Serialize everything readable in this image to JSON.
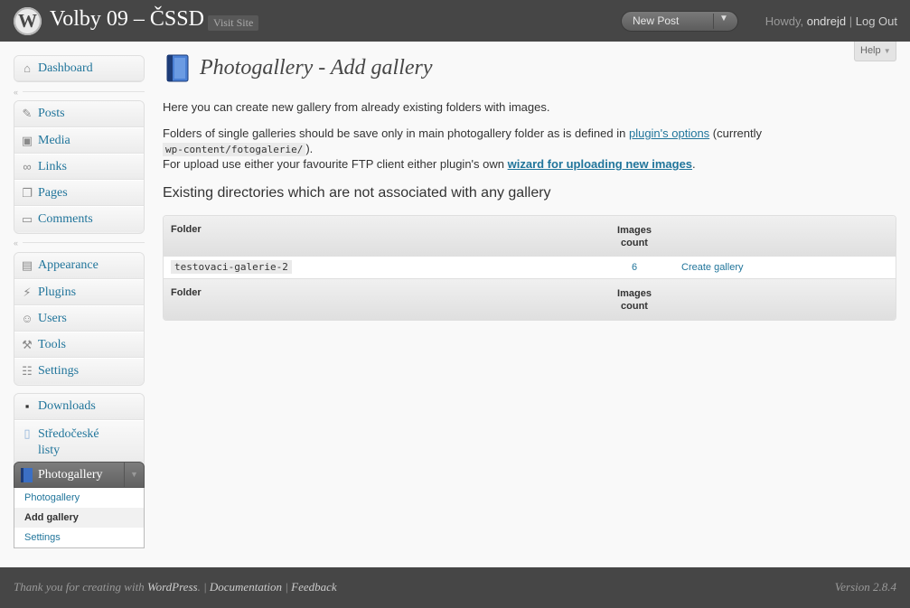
{
  "header": {
    "logo": "W",
    "site_title": "Volby 09 – ČSSD",
    "visit_site": "Visit Site",
    "new_post": "New Post",
    "howdy": "Howdy,",
    "username": "ondrejd",
    "separator": "|",
    "logout": "Log Out"
  },
  "help": "Help",
  "menu": {
    "dashboard": "Dashboard",
    "group2": [
      {
        "label": "Posts",
        "icon": "pin-icon"
      },
      {
        "label": "Media",
        "icon": "media-icon"
      },
      {
        "label": "Links",
        "icon": "links-icon"
      },
      {
        "label": "Pages",
        "icon": "pages-icon"
      },
      {
        "label": "Comments",
        "icon": "comments-icon"
      }
    ],
    "group3": [
      {
        "label": "Appearance",
        "icon": "appearance-icon"
      },
      {
        "label": "Plugins",
        "icon": "plugins-icon"
      },
      {
        "label": "Users",
        "icon": "users-icon"
      },
      {
        "label": "Tools",
        "icon": "tools-icon"
      },
      {
        "label": "Settings",
        "icon": "settings-icon"
      }
    ],
    "downloads": "Downloads",
    "stredoceske_line1": "Středočeské",
    "stredoceske_line2": "listy",
    "photogallery": "Photogallery",
    "submenu": [
      "Photogallery",
      "Add gallery",
      "Settings"
    ]
  },
  "page": {
    "title": "Photogallery - Add gallery",
    "intro": "Here you can create new gallery from already existing folders with images.",
    "folders_text_1": "Folders of single galleries should be save only in main photogallery folder as is defined in ",
    "plugin_options_link": "plugin's options",
    "folders_text_2": " (currently",
    "folder_path": "wp-content/fotogalerie/",
    "folders_text_3": ").",
    "upload_text_1": "For upload use either your favourite FTP client either plugin's own ",
    "wizard_link": "wizard for uploading new images",
    "upload_text_2": ".",
    "section_heading": "Existing directories which are not associated with any gallery"
  },
  "table": {
    "col_folder": "Folder",
    "col_count_1": "Images",
    "col_count_2": "count",
    "rows": [
      {
        "folder": "testovaci-galerie-2",
        "count": "6",
        "action": "Create gallery"
      }
    ]
  },
  "footer": {
    "thanks": "Thank you for creating with ",
    "wordpress": "WordPress",
    "dot": ".",
    "sep": " | ",
    "documentation": "Documentation",
    "feedback": "Feedback",
    "version": "Version 2.8.4"
  }
}
